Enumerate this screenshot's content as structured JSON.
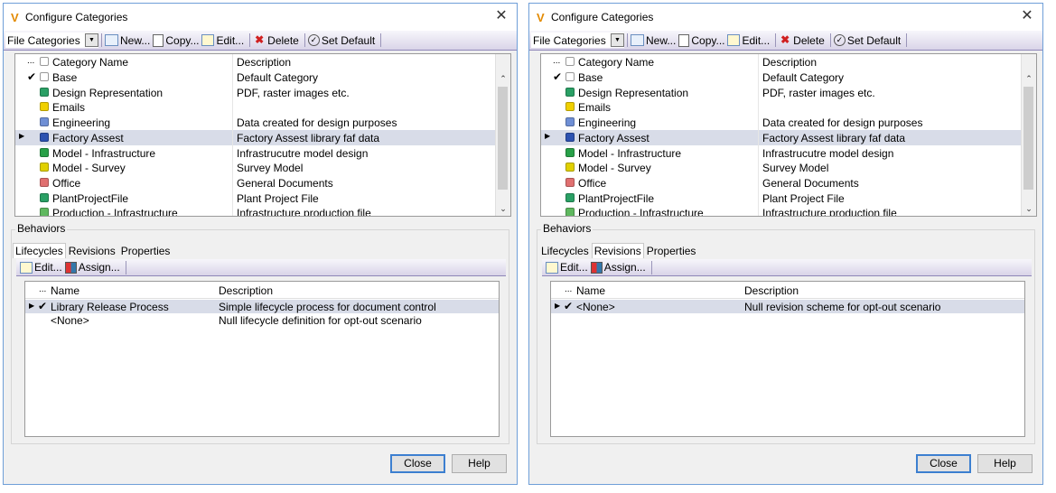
{
  "left": {
    "title": "Configure Categories",
    "close_glyph": "✕",
    "toolbar": {
      "combo_value": "File Categories",
      "new_label": "New...",
      "copy_label": "Copy...",
      "edit_label": "Edit...",
      "delete_label": "Delete",
      "set_default_label": "Set Default"
    },
    "grid": {
      "headers": {
        "dots": "...",
        "name": "Category Name",
        "description": "Description"
      },
      "rows": [
        {
          "name": "Base",
          "description": "Default Category",
          "color": "",
          "check": "✔",
          "marker": ""
        },
        {
          "name": "Design Representation",
          "description": "PDF, raster images etc.",
          "color": "#2aa065",
          "check": "",
          "marker": ""
        },
        {
          "name": "Emails",
          "description": "",
          "color": "#f0d000",
          "check": "",
          "marker": ""
        },
        {
          "name": "Engineering",
          "description": "Data created for design purposes",
          "color": "#6f8fd5",
          "check": "",
          "marker": ""
        },
        {
          "name": "Factory Assest",
          "description": "Factory Assest library faf data",
          "color": "#2d52b0",
          "check": "",
          "marker": "▶"
        },
        {
          "name": "Model - Infrastructure",
          "description": "Infrastrucutre model design",
          "color": "#28a048",
          "check": "",
          "marker": ""
        },
        {
          "name": "Model - Survey",
          "description": "Survey Model",
          "color": "#e0d000",
          "check": "",
          "marker": ""
        },
        {
          "name": "Office",
          "description": "General Documents",
          "color": "#e07070",
          "check": "",
          "marker": ""
        },
        {
          "name": "PlantProjectFile",
          "description": "Plant Project File",
          "color": "#2aa065",
          "check": "",
          "marker": ""
        },
        {
          "name": "Production - Infrastructure",
          "description": "Infrastructure production file",
          "color": "#5fb85f",
          "check": "",
          "marker": ""
        }
      ]
    },
    "behaviors_label": "Behaviors",
    "tabs": [
      "Lifecycles",
      "Revisions",
      "Properties"
    ],
    "active_tab": "Lifecycles",
    "sub_toolbar": {
      "edit_label": "Edit...",
      "assign_label": "Assign..."
    },
    "inner_grid": {
      "headers": {
        "dots": "...",
        "name": "Name",
        "description": "Description"
      },
      "rows": [
        {
          "name": "Library Release Process",
          "description": "Simple lifecycle process for document control",
          "check": "✔",
          "marker": "▶"
        },
        {
          "name": "<None>",
          "description": "Null lifecycle definition for opt-out scenario",
          "check": "",
          "marker": ""
        }
      ]
    },
    "close_button": "Close",
    "help_button": "Help"
  },
  "right": {
    "title": "Configure Categories",
    "close_glyph": "✕",
    "toolbar": {
      "combo_value": "File Categories",
      "new_label": "New...",
      "copy_label": "Copy...",
      "edit_label": "Edit...",
      "delete_label": "Delete",
      "set_default_label": "Set Default"
    },
    "grid": {
      "headers": {
        "dots": "...",
        "name": "Category Name",
        "description": "Description"
      },
      "rows": [
        {
          "name": "Base",
          "description": "Default Category",
          "color": "",
          "check": "✔",
          "marker": ""
        },
        {
          "name": "Design Representation",
          "description": "PDF, raster images etc.",
          "color": "#2aa065",
          "check": "",
          "marker": ""
        },
        {
          "name": "Emails",
          "description": "",
          "color": "#f0d000",
          "check": "",
          "marker": ""
        },
        {
          "name": "Engineering",
          "description": "Data created for design purposes",
          "color": "#6f8fd5",
          "check": "",
          "marker": ""
        },
        {
          "name": "Factory Assest",
          "description": "Factory Assest library faf data",
          "color": "#2d52b0",
          "check": "",
          "marker": "▶"
        },
        {
          "name": "Model - Infrastructure",
          "description": "Infrastrucutre model design",
          "color": "#28a048",
          "check": "",
          "marker": ""
        },
        {
          "name": "Model - Survey",
          "description": "Survey Model",
          "color": "#e0d000",
          "check": "",
          "marker": ""
        },
        {
          "name": "Office",
          "description": "General Documents",
          "color": "#e07070",
          "check": "",
          "marker": ""
        },
        {
          "name": "PlantProjectFile",
          "description": "Plant Project File",
          "color": "#2aa065",
          "check": "",
          "marker": ""
        },
        {
          "name": "Production - Infrastructure",
          "description": "Infrastructure production file",
          "color": "#5fb85f",
          "check": "",
          "marker": ""
        }
      ]
    },
    "behaviors_label": "Behaviors",
    "tabs": [
      "Lifecycles",
      "Revisions",
      "Properties"
    ],
    "active_tab": "Revisions",
    "sub_toolbar": {
      "edit_label": "Edit...",
      "assign_label": "Assign..."
    },
    "inner_grid": {
      "headers": {
        "dots": "...",
        "name": "Name",
        "description": "Description"
      },
      "rows": [
        {
          "name": "<None>",
          "description": "Null revision scheme for opt-out scenario",
          "check": "✔",
          "marker": "▶"
        }
      ]
    },
    "close_button": "Close",
    "help_button": "Help"
  },
  "colors": {
    "selection": "#d8dce8",
    "toolbar_gradient_end": "#d9d4e8",
    "window_border": "#6f9fd8",
    "default_button_border": "#3c7fd0"
  }
}
